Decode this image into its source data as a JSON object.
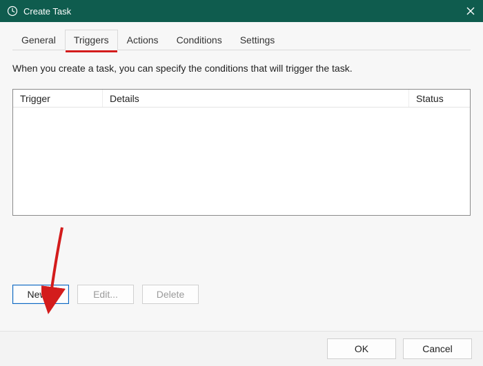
{
  "window": {
    "title": "Create Task"
  },
  "tabs": {
    "general": "General",
    "triggers": "Triggers",
    "actions": "Actions",
    "conditions": "Conditions",
    "settings": "Settings"
  },
  "description": "When you create a task, you can specify the conditions that will trigger the task.",
  "columns": {
    "trigger": "Trigger",
    "details": "Details",
    "status": "Status"
  },
  "buttons": {
    "new": "New...",
    "edit": "Edit...",
    "delete": "Delete",
    "ok": "OK",
    "cancel": "Cancel"
  }
}
